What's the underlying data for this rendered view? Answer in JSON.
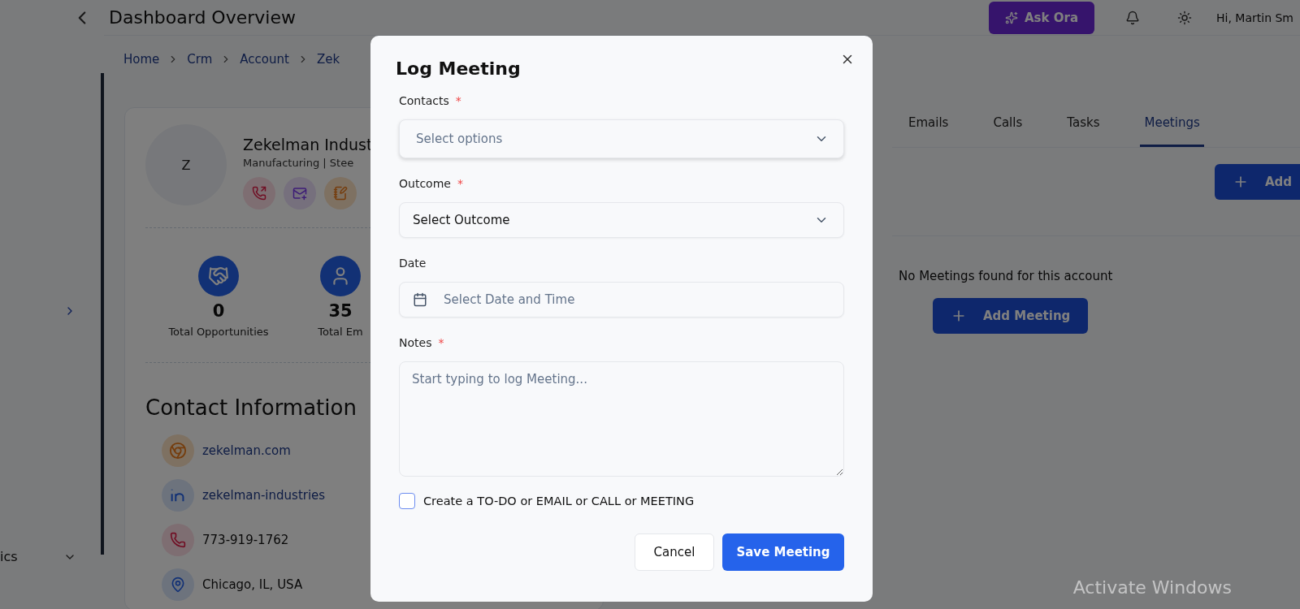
{
  "header": {
    "title": "Dashboard Overview",
    "ask_button": "Ask Ora",
    "greeting": "Hi, Martin Sm"
  },
  "sidebar": {
    "items": [
      {
        "kind": "collapsed"
      },
      {
        "kind": "menu",
        "label": "ics"
      }
    ]
  },
  "breadcrumb": [
    "Home",
    "Crm",
    "Account",
    "Zek"
  ],
  "account": {
    "avatar": "Z",
    "name": "Zekelman Indust",
    "subtitle": "Manufacturing | Stee"
  },
  "stats": [
    {
      "kind": "opportunities",
      "value": "0",
      "label": "Total Opportunities"
    },
    {
      "kind": "employees",
      "value": "35",
      "label": "Total Em"
    }
  ],
  "contact_info": {
    "title": "Contact Information",
    "items": [
      {
        "kind": "website",
        "text": "zekelman.com"
      },
      {
        "kind": "profile",
        "text": "zekelman-industries"
      },
      {
        "kind": "phone",
        "text": "773-919-1762"
      },
      {
        "kind": "location",
        "text": "Chicago, IL, USA"
      }
    ]
  },
  "tabs": [
    {
      "label": "Emails",
      "selected": false
    },
    {
      "label": "Calls",
      "selected": false
    },
    {
      "label": "Tasks",
      "selected": false
    },
    {
      "label": "Meetings",
      "selected": true
    }
  ],
  "top_add_button": "Add",
  "empty_message": "No Meetings found for this account",
  "add_meeting_button": "Add Meeting",
  "modal": {
    "title": "Log Meeting",
    "fields": [
      {
        "kind": "select",
        "label": "Contacts",
        "marker": "*",
        "placeholder": "Select options"
      },
      {
        "kind": "select",
        "label": "Outcome",
        "marker": "*",
        "value": "Select Outcome"
      },
      {
        "kind": "date",
        "label": "Date",
        "placeholder": "Select Date and Time"
      },
      {
        "kind": "textarea",
        "label": "Notes",
        "marker": "*",
        "placeholder": "Start typing to log Meeting..."
      }
    ],
    "checkbox": {
      "label": "Create a TO-DO or EMAIL or CALL or MEETING",
      "checked": false
    },
    "cancel_button": "Cancel",
    "save_button": "Save Meeting"
  },
  "os_notice": "Activate Windows"
}
